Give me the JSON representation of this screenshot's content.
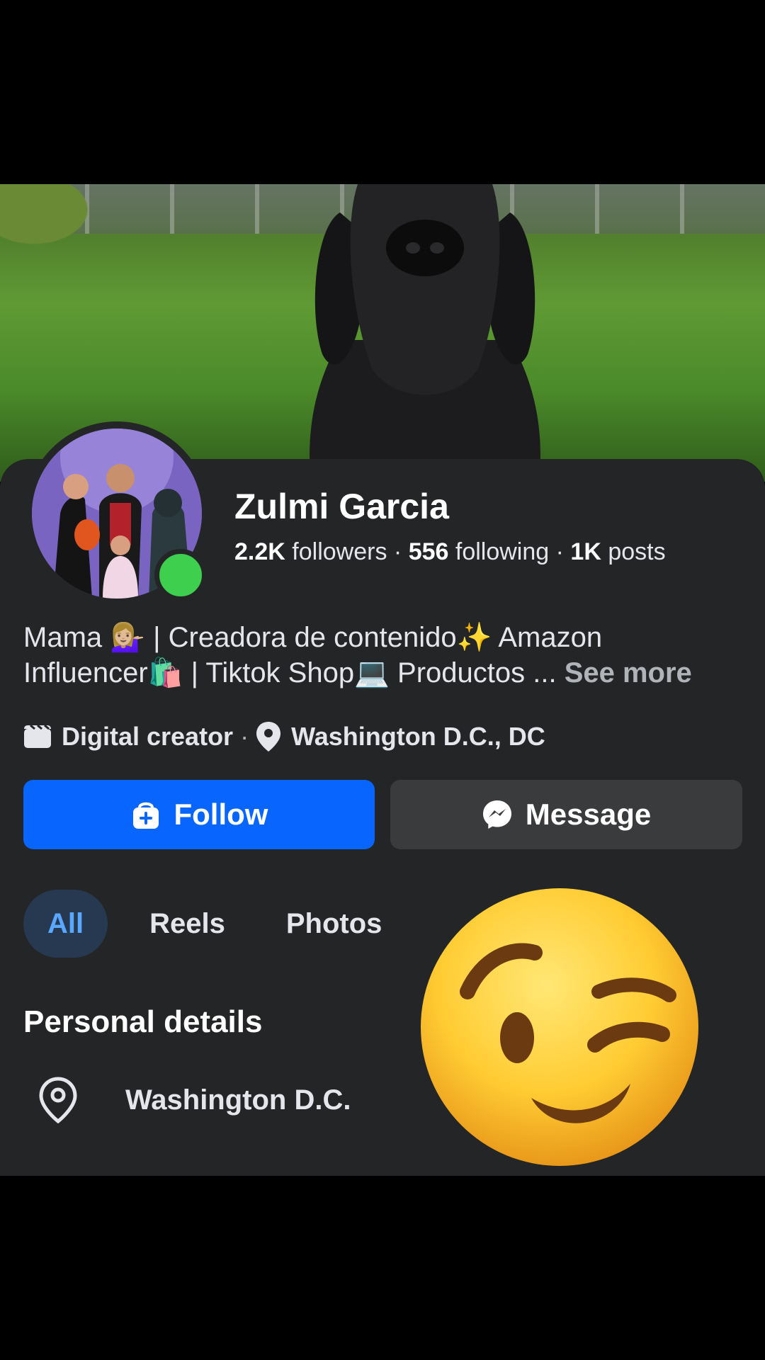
{
  "profile": {
    "name": "Zulmi Garcia",
    "followers_count": "2.2K",
    "followers_label": "followers",
    "following_count": "556",
    "following_label": "following",
    "posts_count": "1K",
    "posts_label": "posts",
    "separator": "·",
    "bio_line1": "Mama 💁🏼‍♀️ | Creadora de contenido✨ Amazon",
    "bio_line2": "Influencer🛍️ | Tiktok Shop💻 Productos ...",
    "see_more": "See more",
    "category": "Digital creator",
    "location": "Washington D.C., DC"
  },
  "actions": {
    "follow_label": "Follow",
    "message_label": "Message",
    "follow_color": "#0866ff"
  },
  "tabs": [
    {
      "label": "All",
      "active": true
    },
    {
      "label": "Reels",
      "active": false
    },
    {
      "label": "Photos",
      "active": false
    }
  ],
  "personal_details": {
    "title": "Personal details",
    "location": "Washington D.C."
  },
  "icons": {
    "category": "clapperboard-icon",
    "location": "map-pin-icon",
    "follow": "add-friend-icon",
    "message": "messenger-icon",
    "overlay": "winking-face-emoji"
  },
  "status": {
    "online": true,
    "online_color": "#3ecf4e"
  }
}
